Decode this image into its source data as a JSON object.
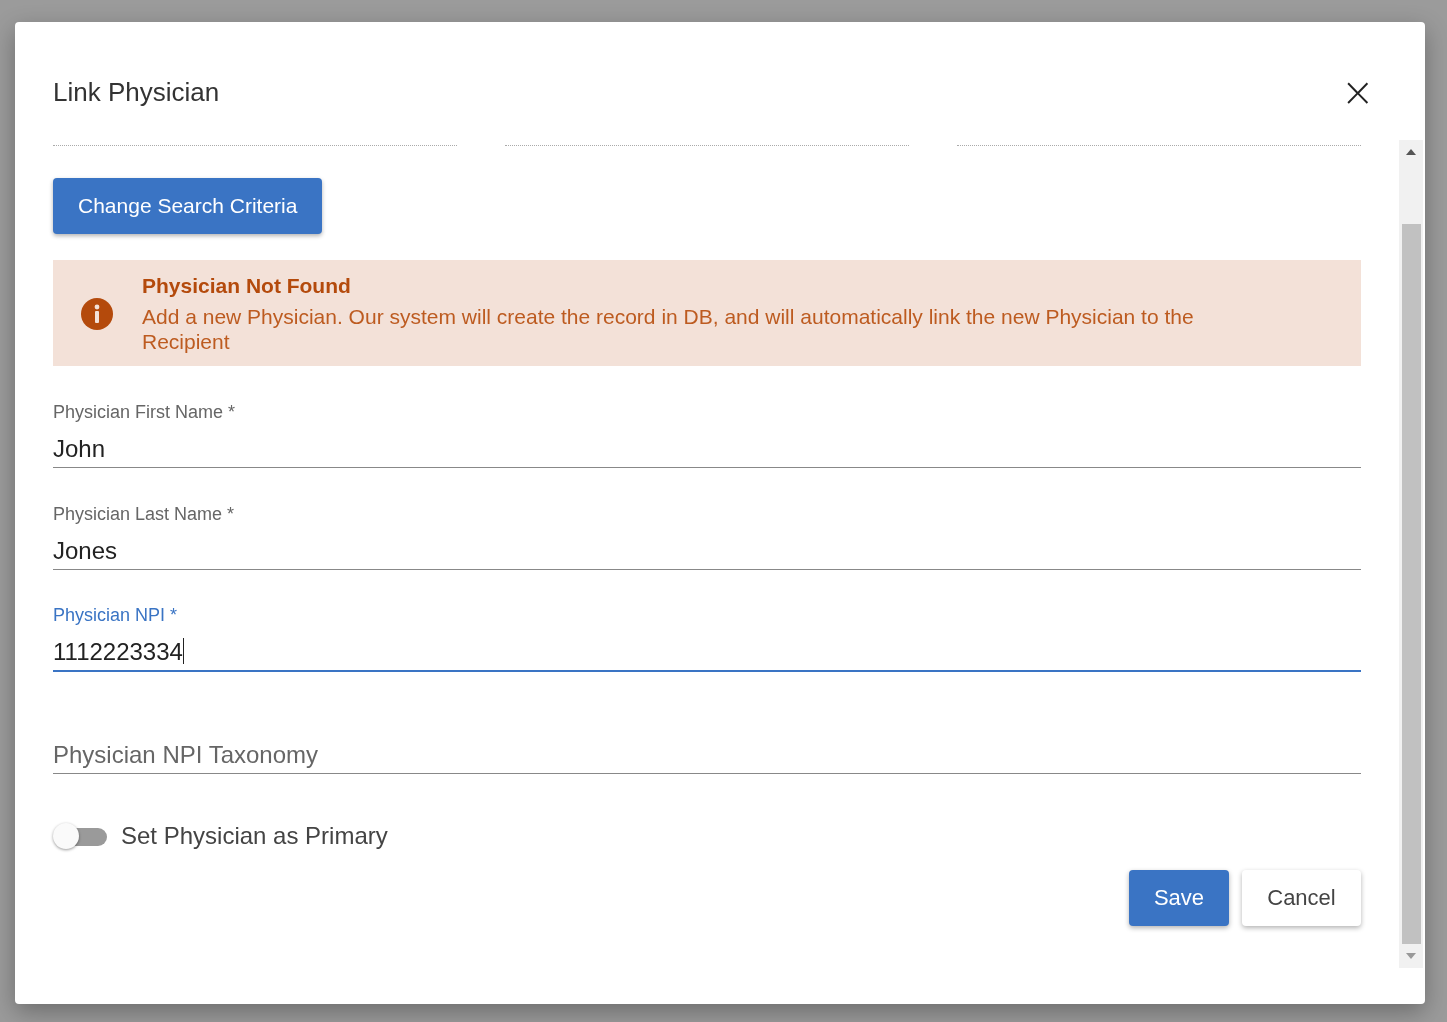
{
  "dialog": {
    "title": "Link Physician",
    "close_icon": "×"
  },
  "change_button": "Change Search Criteria",
  "alert": {
    "title": "Physician Not Found",
    "message": "Add a new Physician. Our system will create the record in DB, and will automatically link the new Physician to the Recipient"
  },
  "fields": [
    {
      "label": "Physician First Name *",
      "value": "John",
      "focused": false
    },
    {
      "label": "Physician Last Name *",
      "value": "Jones",
      "focused": false
    },
    {
      "label": "Physician NPI *",
      "value": "1112223334",
      "focused": true
    },
    {
      "placeholder": "Physician NPI Taxonomy",
      "focused": false
    }
  ],
  "toggle": {
    "label": "Set Physician as Primary",
    "on": false
  },
  "buttons": [
    {
      "label": "Save",
      "kind": "primary"
    },
    {
      "label": "Cancel",
      "kind": "secondary"
    }
  ]
}
